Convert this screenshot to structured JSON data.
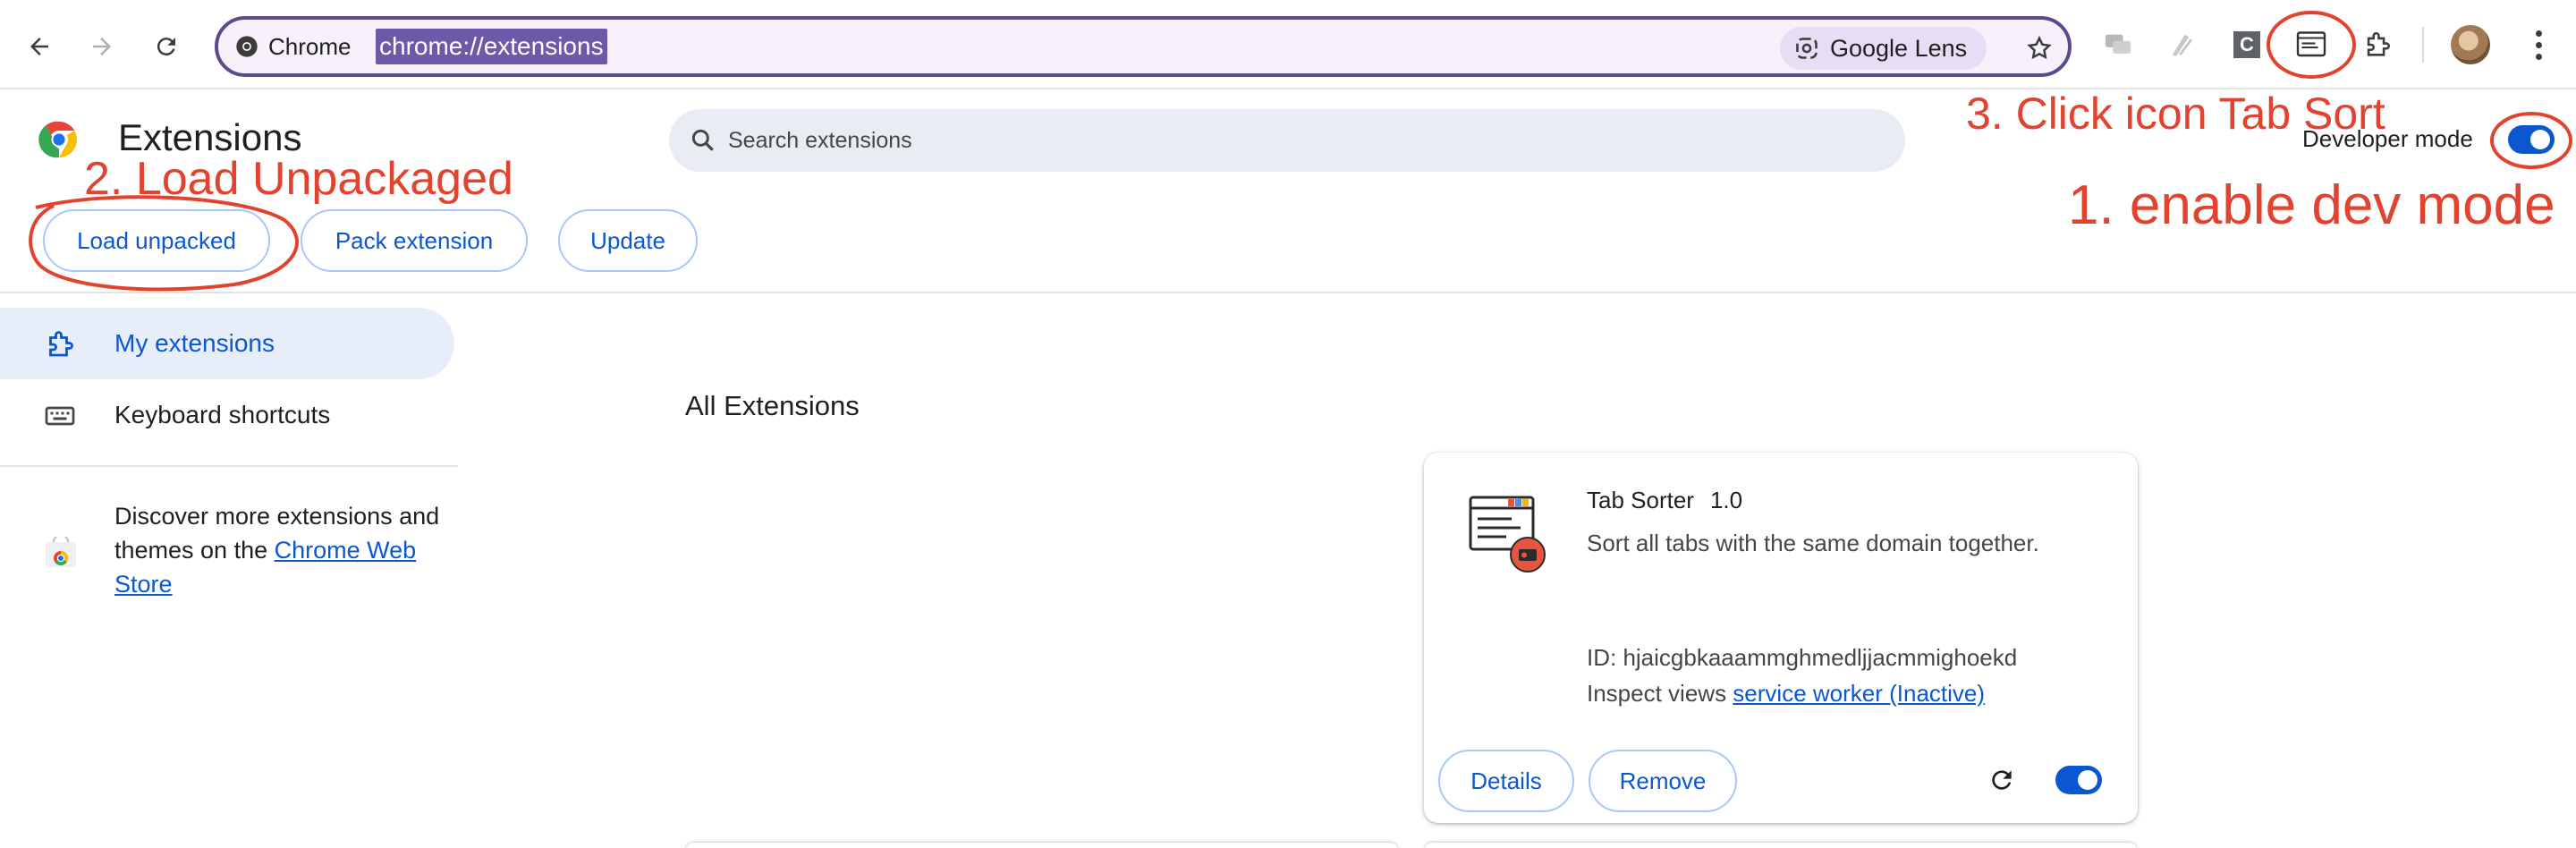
{
  "browser": {
    "origin_chip": "Chrome",
    "url": "chrome://extensions",
    "lens_label": "Google Lens",
    "icons": [
      "back-arrow-icon",
      "forward-arrow-icon",
      "reload-icon",
      "chrome-icon",
      "google-lens-icon",
      "bookmark-star-icon",
      "chat-extension-icon",
      "pen-extension-icon",
      "c-extension-icon",
      "tab-sorter-extension-icon",
      "extensions-puzzle-icon",
      "profile-avatar",
      "more-menu-icon"
    ],
    "c_extension_letter": "C"
  },
  "header": {
    "title": "Extensions",
    "search_placeholder": "Search extensions",
    "developer_mode_label": "Developer mode",
    "developer_mode_on": true,
    "buttons": {
      "load_unpacked": "Load unpacked",
      "pack_extension": "Pack extension",
      "update": "Update"
    }
  },
  "sidebar": {
    "items": [
      {
        "label": "My extensions",
        "icon": "puzzle-icon",
        "active": true
      },
      {
        "label": "Keyboard shortcuts",
        "icon": "keyboard-icon",
        "active": false
      }
    ],
    "discover_text": "Discover more extensions and themes on the ",
    "discover_link": "Chrome Web Store"
  },
  "main": {
    "section_title": "All Extensions",
    "extension": {
      "name": "Tab Sorter",
      "version": "1.0",
      "description": "Sort all tabs with the same domain together.",
      "id_text": "ID: hjaicgbkaaammghmedljjacmmighoekd",
      "inspect_label": "Inspect views ",
      "inspect_link": "service worker (Inactive)",
      "details_label": "Details",
      "remove_label": "Remove",
      "enabled": true
    }
  },
  "annotations": {
    "step1": "1. enable dev mode",
    "step2": "2. Load Unpackaged",
    "step3": "3. Click icon Tab Sort",
    "color": "#e2432f"
  },
  "colors": {
    "accent": "#0b57d0",
    "omnibox_border": "#5b4a8c",
    "url_highlight": "#6c5aa8",
    "annotation_red": "#e2432f"
  }
}
